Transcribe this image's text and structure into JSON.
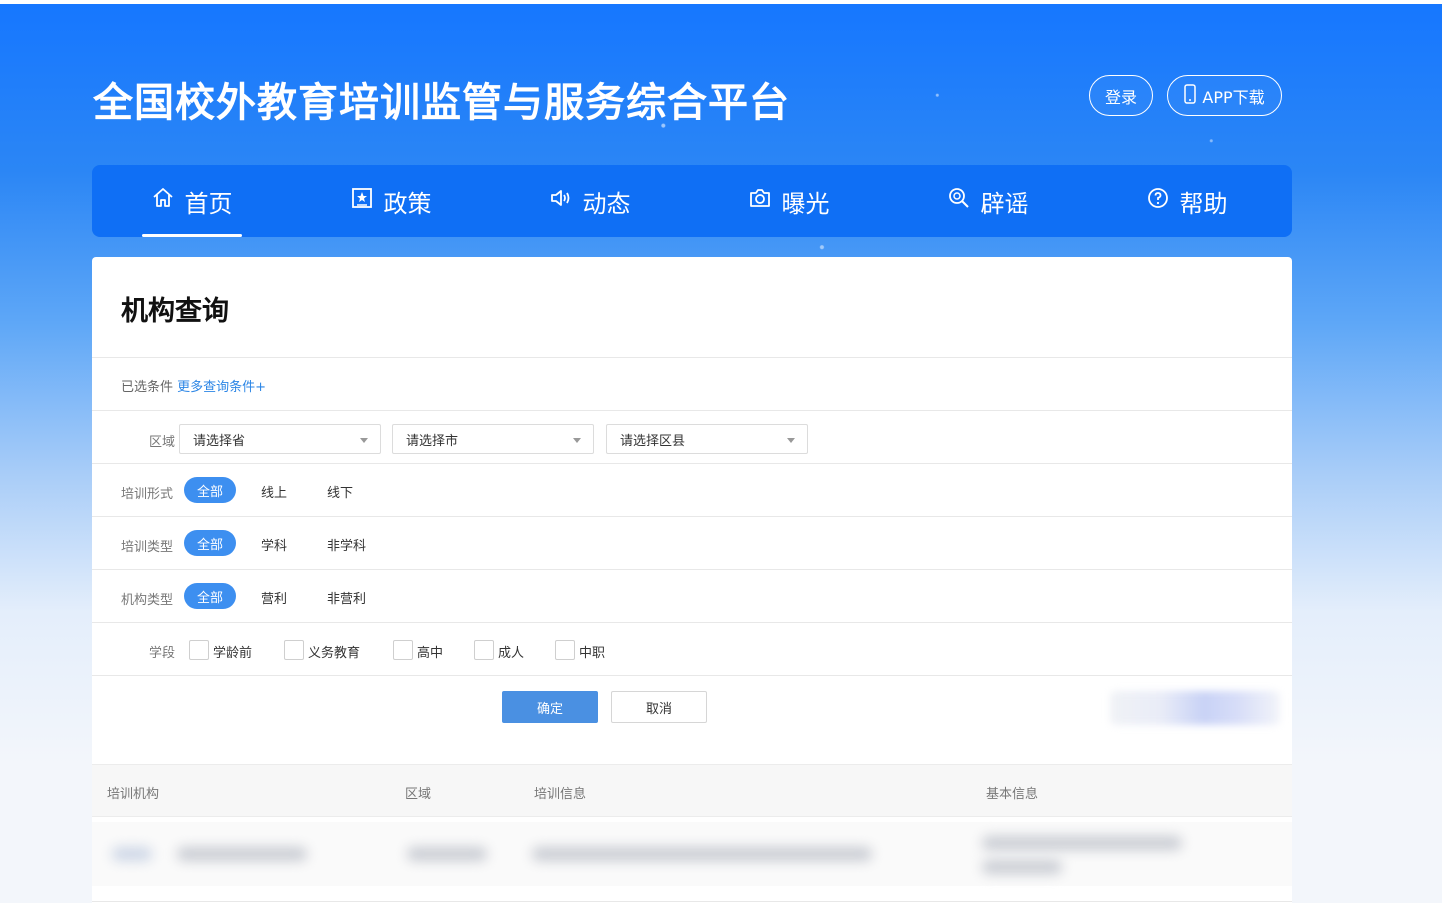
{
  "header": {
    "title": "全国校外教育培训监管与服务综合平台",
    "login_label": "登录",
    "app_download_label": "APP下载"
  },
  "nav": {
    "items": [
      {
        "label": "首页",
        "icon": "home-icon"
      },
      {
        "label": "政策",
        "icon": "policy-icon"
      },
      {
        "label": "动态",
        "icon": "speaker-icon"
      },
      {
        "label": "曝光",
        "icon": "camera-icon"
      },
      {
        "label": "辟谣",
        "icon": "magnifier-icon"
      },
      {
        "label": "帮助",
        "icon": "question-icon"
      }
    ],
    "active_index": 0
  },
  "panel": {
    "title": "机构查询",
    "selected_conditions_label": "已选条件",
    "more_conditions_link": "更多查询条件+"
  },
  "filters": {
    "region": {
      "label": "区域",
      "province_placeholder": "请选择省",
      "city_placeholder": "请选择市",
      "county_placeholder": "请选择区县"
    },
    "training_form": {
      "label": "培训形式",
      "all": "全部",
      "options": [
        "线上",
        "线下"
      ]
    },
    "training_type": {
      "label": "培训类型",
      "all": "全部",
      "options": [
        "学科",
        "非学科"
      ]
    },
    "org_type": {
      "label": "机构类型",
      "all": "全部",
      "options": [
        "营利",
        "非营利"
      ]
    },
    "stage": {
      "label": "学段",
      "options": [
        "学龄前",
        "义务教育",
        "高中",
        "成人",
        "中职"
      ]
    }
  },
  "actions": {
    "confirm_label": "确定",
    "cancel_label": "取消"
  },
  "table": {
    "columns": [
      "培训机构",
      "区域",
      "培训信息",
      "基本信息"
    ]
  },
  "colors": {
    "brand_blue": "#1677ff",
    "nav_blue": "#0f6ff5",
    "pill_blue": "#3d8ff0",
    "link_blue": "#2c86e6"
  }
}
